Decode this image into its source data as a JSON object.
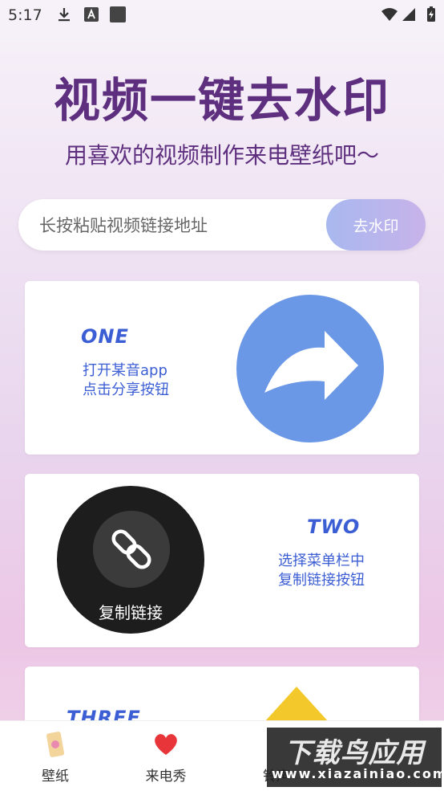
{
  "status": {
    "time": "5:17"
  },
  "header": {
    "title": "视频一键去水印",
    "subtitle": "用喜欢的视频制作来电壁纸吧～"
  },
  "search": {
    "placeholder": "长按粘贴视频链接地址",
    "button_label": "去水印"
  },
  "steps": [
    {
      "label": "ONE",
      "text": "打开某音app\n点击分享按钮"
    },
    {
      "label": "TWO",
      "text": "选择菜单栏中\n复制链接按钮",
      "circle_caption": "复制链接"
    },
    {
      "label": "THREE"
    }
  ],
  "nav": {
    "items": [
      {
        "label": "壁纸",
        "icon": "wallpaper-icon"
      },
      {
        "label": "来电秀",
        "icon": "heart-icon"
      },
      {
        "label": "铃声",
        "icon": "ringtone-icon"
      }
    ]
  },
  "watermark": {
    "main": "下载鸟应用",
    "sub": "www.xiazainiao.com"
  },
  "colors": {
    "accent_purple": "#5e2f7f",
    "step_blue": "#3c5ed4",
    "share_blue": "#6a98e6"
  }
}
